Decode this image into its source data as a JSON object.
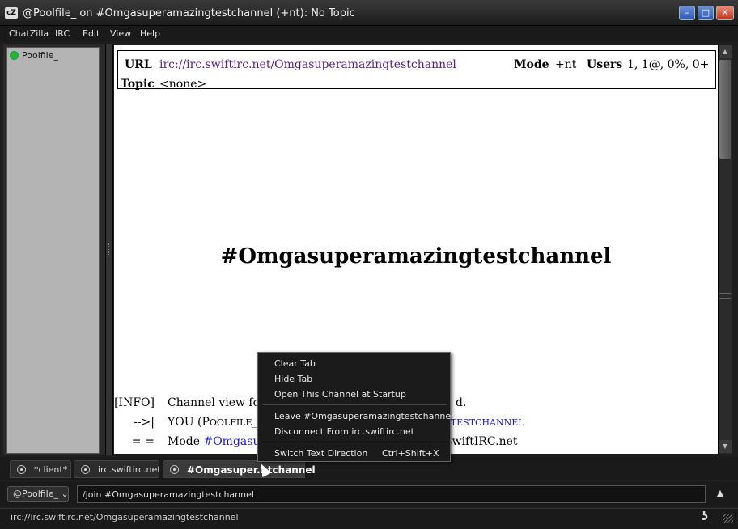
{
  "window": {
    "title": "@Poolfile_ on #Omgasuperamazingtestchannel (+nt): No Topic",
    "app_icon": "cZ",
    "minimize": "–",
    "maximize": "□",
    "close": "✕"
  },
  "menubar": [
    "ChatZilla",
    "IRC",
    "Edit",
    "View",
    "Help"
  ],
  "userlist": {
    "users": [
      {
        "name": "Poolfile_",
        "status_color": "#2fae2f"
      }
    ]
  },
  "channel_header": {
    "url_label": "URL",
    "url": "irc://irc.swiftirc.net/Omgasuperamazingtestchannel",
    "mode_label": "Mode",
    "mode": "+nt",
    "users_label": "Users",
    "users": "1, 1@, 0%, 0+",
    "topic_label": "Topic",
    "topic": "<none>"
  },
  "channel_title": "#Omgasuperamazingtestchannel",
  "log": [
    {
      "tag": "[INFO]",
      "parts": [
        "Channel view for “",
        "d."
      ]
    },
    {
      "tag": "-->|",
      "parts": [
        "YOU (",
        "P",
        "OOLFILE_",
        "GTESTCHANNEL"
      ]
    },
    {
      "tag": "=-=",
      "parts": [
        "Mode ",
        "#Omgasupe",
        "SwiftIRC.net"
      ]
    }
  ],
  "context_menu": {
    "items": [
      {
        "label": "Clear Tab"
      },
      {
        "label": "Hide Tab"
      },
      {
        "label": "Open This Channel at Startup"
      },
      {
        "label": "Leave #Omgasuperamazingtestchannel"
      },
      {
        "label": "Disconnect From irc.swiftirc.net"
      },
      {
        "label": "Switch Text Direction",
        "shortcut": "Ctrl+Shift+X"
      }
    ]
  },
  "tabs": [
    {
      "label": "*client*"
    },
    {
      "label": "irc.swiftirc.net"
    },
    {
      "label": "#Omgasuper...tchannel"
    }
  ],
  "input": {
    "nick": "@Poolfile_",
    "nick_arrow": "⌄",
    "value": "/join #Omgasuperamazingtestchannel",
    "multiline_toggle": "▲"
  },
  "status": {
    "text": "irc://irc.swiftirc.net/Omgasuperamazingtestchannel",
    "icon_glyph": "ʖ"
  }
}
